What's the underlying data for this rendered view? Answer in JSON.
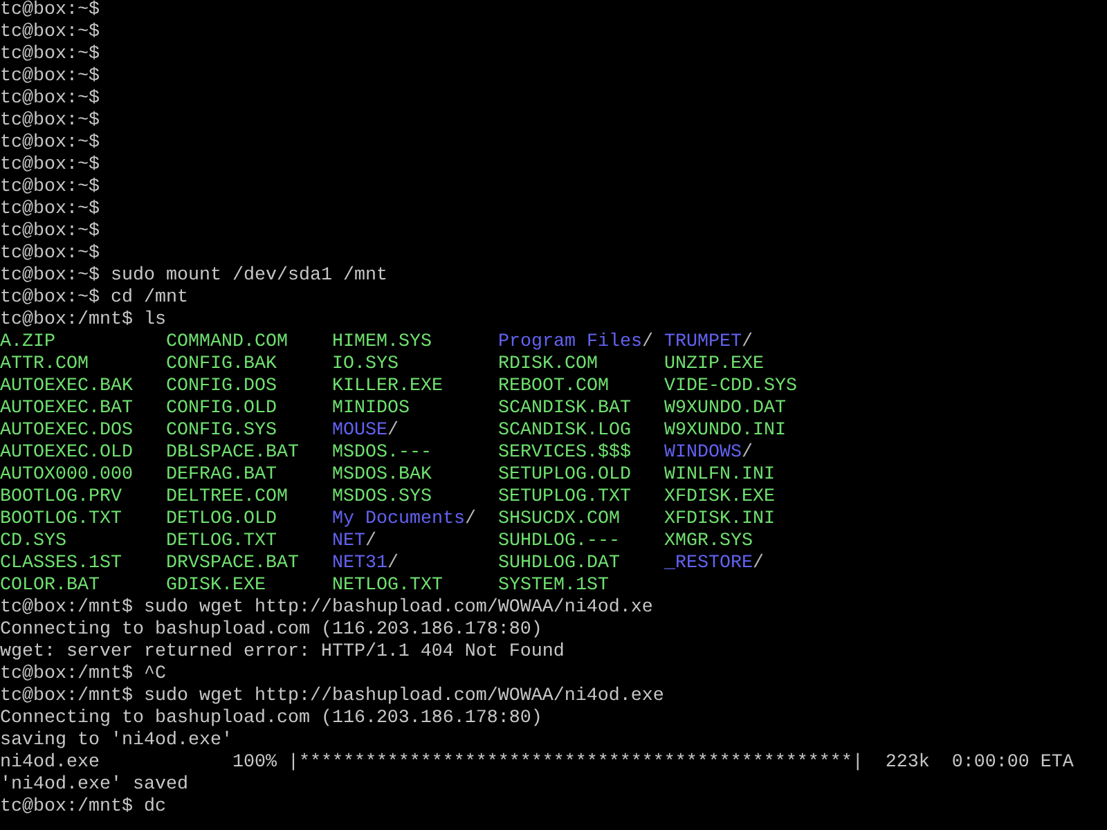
{
  "terminal": {
    "lines_before": [
      "tc@box:~$",
      "tc@box:~$",
      "tc@box:~$",
      "tc@box:~$",
      "tc@box:~$",
      "tc@box:~$",
      "tc@box:~$",
      "tc@box:~$",
      "tc@box:~$",
      "tc@box:~$",
      "tc@box:~$",
      "tc@box:~$",
      "tc@box:~$ sudo mount /dev/sda1 /mnt",
      "tc@box:~$ cd /mnt",
      "tc@box:/mnt$ ls"
    ],
    "listing": [
      [
        {
          "kind": "file",
          "name": "A.ZIP"
        },
        {
          "kind": "file",
          "name": "COMMAND.COM"
        },
        {
          "kind": "file",
          "name": "HIMEM.SYS"
        },
        {
          "kind": "dir",
          "name": "Program Files",
          "suffix": "/"
        },
        {
          "kind": "dir",
          "name": "TRUMPET",
          "suffix": "/"
        }
      ],
      [
        {
          "kind": "file",
          "name": "ATTR.COM"
        },
        {
          "kind": "file",
          "name": "CONFIG.BAK"
        },
        {
          "kind": "file",
          "name": "IO.SYS"
        },
        {
          "kind": "file",
          "name": "RDISK.COM"
        },
        {
          "kind": "file",
          "name": "UNZIP.EXE"
        }
      ],
      [
        {
          "kind": "file",
          "name": "AUTOEXEC.BAK"
        },
        {
          "kind": "file",
          "name": "CONFIG.DOS"
        },
        {
          "kind": "file",
          "name": "KILLER.EXE"
        },
        {
          "kind": "file",
          "name": "REBOOT.COM"
        },
        {
          "kind": "file",
          "name": "VIDE-CDD.SYS"
        }
      ],
      [
        {
          "kind": "file",
          "name": "AUTOEXEC.BAT"
        },
        {
          "kind": "file",
          "name": "CONFIG.OLD"
        },
        {
          "kind": "file",
          "name": "MINIDOS"
        },
        {
          "kind": "file",
          "name": "SCANDISK.BAT"
        },
        {
          "kind": "file",
          "name": "W9XUNDO.DAT"
        }
      ],
      [
        {
          "kind": "file",
          "name": "AUTOEXEC.DOS"
        },
        {
          "kind": "file",
          "name": "CONFIG.SYS"
        },
        {
          "kind": "dir",
          "name": "MOUSE",
          "suffix": "/"
        },
        {
          "kind": "file",
          "name": "SCANDISK.LOG"
        },
        {
          "kind": "file",
          "name": "W9XUNDO.INI"
        }
      ],
      [
        {
          "kind": "file",
          "name": "AUTOEXEC.OLD"
        },
        {
          "kind": "file",
          "name": "DBLSPACE.BAT"
        },
        {
          "kind": "file",
          "name": "MSDOS.---"
        },
        {
          "kind": "file",
          "name": "SERVICES.$$$"
        },
        {
          "kind": "dir",
          "name": "WINDOWS",
          "suffix": "/"
        }
      ],
      [
        {
          "kind": "file",
          "name": "AUTOX000.000"
        },
        {
          "kind": "file",
          "name": "DEFRAG.BAT"
        },
        {
          "kind": "file",
          "name": "MSDOS.BAK"
        },
        {
          "kind": "file",
          "name": "SETUPLOG.OLD"
        },
        {
          "kind": "file",
          "name": "WINLFN.INI"
        }
      ],
      [
        {
          "kind": "file",
          "name": "BOOTLOG.PRV"
        },
        {
          "kind": "file",
          "name": "DELTREE.COM"
        },
        {
          "kind": "file",
          "name": "MSDOS.SYS"
        },
        {
          "kind": "file",
          "name": "SETUPLOG.TXT"
        },
        {
          "kind": "file",
          "name": "XFDISK.EXE"
        }
      ],
      [
        {
          "kind": "file",
          "name": "BOOTLOG.TXT"
        },
        {
          "kind": "file",
          "name": "DETLOG.OLD"
        },
        {
          "kind": "dir",
          "name": "My Documents",
          "suffix": "/"
        },
        {
          "kind": "file",
          "name": "SHSUCDX.COM"
        },
        {
          "kind": "file",
          "name": "XFDISK.INI"
        }
      ],
      [
        {
          "kind": "file",
          "name": "CD.SYS"
        },
        {
          "kind": "file",
          "name": "DETLOG.TXT"
        },
        {
          "kind": "dir",
          "name": "NET",
          "suffix": "/"
        },
        {
          "kind": "file",
          "name": "SUHDLOG.---"
        },
        {
          "kind": "file",
          "name": "XMGR.SYS"
        }
      ],
      [
        {
          "kind": "file",
          "name": "CLASSES.1ST"
        },
        {
          "kind": "file",
          "name": "DRVSPACE.BAT"
        },
        {
          "kind": "dir",
          "name": "NET31",
          "suffix": "/"
        },
        {
          "kind": "file",
          "name": "SUHDLOG.DAT"
        },
        {
          "kind": "dir",
          "name": "_RESTORE",
          "suffix": "/"
        }
      ],
      [
        {
          "kind": "file",
          "name": "COLOR.BAT"
        },
        {
          "kind": "file",
          "name": "GDISK.EXE"
        },
        {
          "kind": "file",
          "name": "NETLOG.TXT"
        },
        {
          "kind": "file",
          "name": "SYSTEM.1ST"
        }
      ]
    ],
    "lines_after": [
      "tc@box:/mnt$ sudo wget http://bashupload.com/WOWAA/ni4od.xe",
      "Connecting to bashupload.com (116.203.186.178:80)",
      "wget: server returned error: HTTP/1.1 404 Not Found",
      "tc@box:/mnt$ ^C",
      "tc@box:/mnt$ sudo wget http://bashupload.com/WOWAA/ni4od.exe",
      "Connecting to bashupload.com (116.203.186.178:80)",
      "saving to 'ni4od.exe'",
      "ni4od.exe            100% |**************************************************|  223k  0:00:00 ETA",
      "'ni4od.exe' saved",
      "tc@box:/mnt$ dc"
    ]
  }
}
